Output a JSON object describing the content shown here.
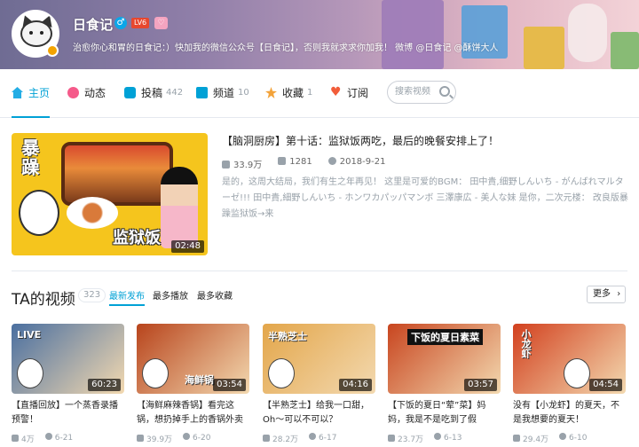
{
  "profile": {
    "username": "日食记",
    "gender_badge": "♂",
    "level_badge": "LV6",
    "vip_badge": "♡",
    "signature": "治愈你心和胃的日食记：）快加我的微信公众号【日食记】，否则我就求求你加我！ 微博 @日食记 @酥饼大人"
  },
  "nav": {
    "items": [
      {
        "label": "主页",
        "count": "",
        "icon": "home-icon",
        "active": true
      },
      {
        "label": "动态",
        "count": "",
        "icon": "dynamic-icon"
      },
      {
        "label": "投稿",
        "count": "442",
        "icon": "upload-icon"
      },
      {
        "label": "频道",
        "count": "10",
        "icon": "channel-icon"
      },
      {
        "label": "收藏",
        "count": "1",
        "icon": "star-icon"
      },
      {
        "label": "订阅",
        "count": "",
        "icon": "heart-icon"
      }
    ],
    "search_placeholder": "搜索视频"
  },
  "featured": {
    "title": "【脑洞厨房】第十话：监狱饭两吃，最后的晚餐安排上了！",
    "thumb_text_1": "暴躁",
    "thumb_text_2": "监狱饭",
    "duration": "02:48",
    "views": "33.9万",
    "danmaku": "1281",
    "date": "2018-9-21",
    "description": "是的，这周大结局，我们有生之年再见！ 这里是可爱的BGM： 田中貴,细野しんいち - がんばれマルターゼ!!! 田中貴,細野しんいち - ホンワカパッパマンボ 三澤康広 - 美人な妹 是你，二次元楼： 改良版暴躁监狱饭→来"
  },
  "videos_section": {
    "title": "TA的视频",
    "count": "323",
    "sort_tabs": [
      "最新发布",
      "最多播放",
      "最多收藏"
    ],
    "more_label": "更多"
  },
  "videos": [
    {
      "title": "【直播回放】一个蒸香录播预警！",
      "duration": "60:23",
      "views": "4万",
      "date": "6-21",
      "thumb_text": "LIVE",
      "color": "#4a6fa0"
    },
    {
      "title": "【海鲜麻辣香锅】看完这锅，想扔掉手上的香锅外卖了！",
      "duration": "03:54",
      "views": "39.9万",
      "date": "6-20",
      "thumb_text": "海鲜锅",
      "color": "#b8441c"
    },
    {
      "title": "【半熟芝士】给我一口甜，Oh～可以不可以？",
      "duration": "04:16",
      "views": "28.2万",
      "date": "6-17",
      "thumb_text": "半熟芝士",
      "color": "#e3a64a"
    },
    {
      "title": "【下饭的夏日“荤”菜】妈妈，我是不是吃到了假肉？！",
      "duration": "03:57",
      "views": "23.7万",
      "date": "6-13",
      "thumb_text": "下饭的夏日素菜",
      "color": "#c8451f"
    },
    {
      "title": "没有【小龙虾】的夏天，不是我想要的夏天！",
      "duration": "04:54",
      "views": "29.4万",
      "date": "6-10",
      "thumb_text": "小龙虾",
      "color": "#d2401e"
    }
  ],
  "colors": {
    "accent": "#00a1d6",
    "muted": "#99a2aa"
  }
}
